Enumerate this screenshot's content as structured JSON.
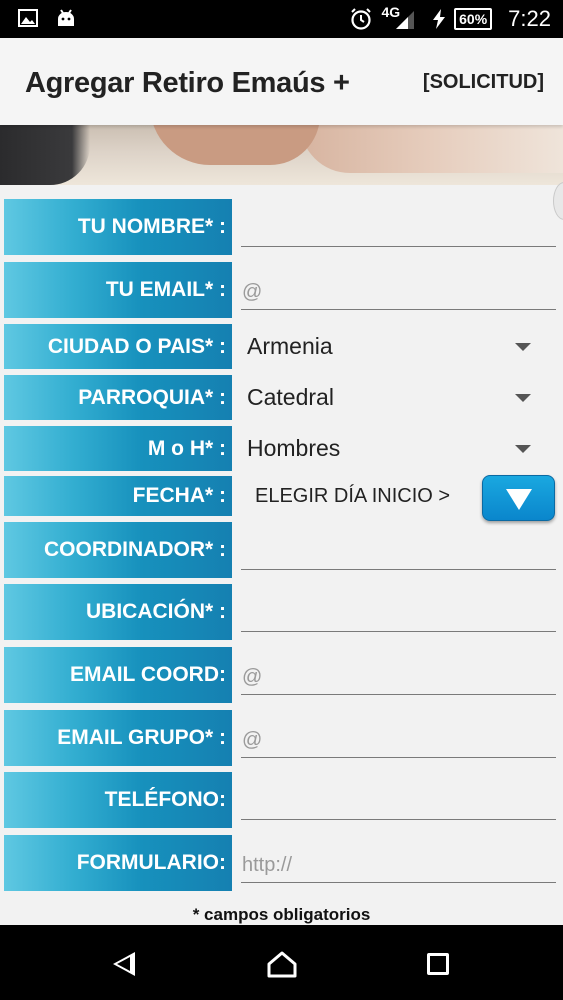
{
  "status_bar": {
    "network": "4G",
    "battery": "60%",
    "time": "7:22",
    "icons": [
      "gallery-icon",
      "android-icon",
      "alarm-icon",
      "signal-icon",
      "charging-icon",
      "battery-icon"
    ]
  },
  "app_bar": {
    "title": "Agregar Retiro Emaús +",
    "action": "[SOLICITUD]"
  },
  "form": {
    "nombre": {
      "label": "TU NOMBRE* :",
      "value": ""
    },
    "email": {
      "label": "TU EMAIL* :",
      "placeholder": "@"
    },
    "ciudad": {
      "label": "CIUDAD O PAIS* :",
      "value": "Armenia"
    },
    "parroquia": {
      "label": "PARROQUIA* :",
      "value": "Catedral"
    },
    "mh": {
      "label": "M o H* :",
      "value": "Hombres"
    },
    "fecha": {
      "label": "FECHA* :",
      "button_text": "ELEGIR DÍA INICIO >"
    },
    "coordinador": {
      "label": "COORDINADOR* :",
      "value": ""
    },
    "ubicacion": {
      "label": "UBICACIÓN* :",
      "value": ""
    },
    "email_coord": {
      "label": "EMAIL COORD:",
      "placeholder": "@"
    },
    "email_grupo": {
      "label": "EMAIL GRUPO* :",
      "placeholder": "@"
    },
    "telefono": {
      "label": "TELÉFONO:",
      "value": ""
    },
    "formulario": {
      "label": "FORMULARIO:",
      "placeholder": "http://"
    }
  },
  "footnote": "* campos obligatorios",
  "colors": {
    "label_gradient_start": "#5fc8e2",
    "label_gradient_end": "#1580b1",
    "button_blue": "#0a86cc"
  }
}
